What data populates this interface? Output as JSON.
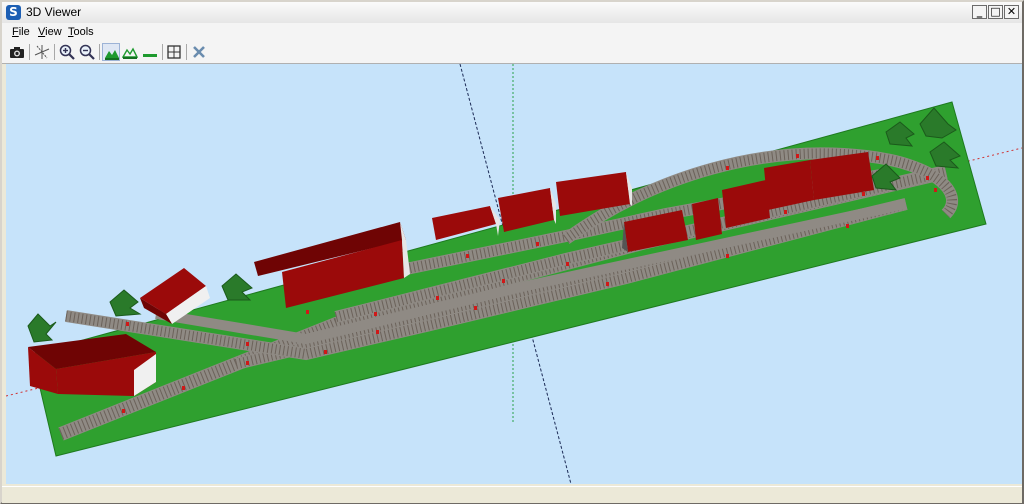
{
  "window": {
    "title": "3D Viewer"
  },
  "controls": {
    "minimize": "_",
    "maximize": "□",
    "close": "✕"
  },
  "menu": [
    {
      "label": "File",
      "accel": "F",
      "rest": "ile"
    },
    {
      "label": "View",
      "accel": "V",
      "rest": "iew"
    },
    {
      "label": "Tools",
      "accel": "T",
      "rest": "ools"
    }
  ],
  "toolbar": {
    "buttons": [
      {
        "icon": "camera-icon"
      },
      {
        "icon": "axes-icon"
      },
      {
        "icon": "zoom-in-icon"
      },
      {
        "icon": "zoom-out-icon"
      },
      {
        "icon": "terrain-view-icon",
        "active": true
      },
      {
        "icon": "terrain-wire-icon"
      },
      {
        "icon": "flat-view-icon"
      },
      {
        "icon": "fit-view-icon"
      },
      {
        "icon": "close-tool-icon"
      }
    ]
  },
  "scene": {
    "sky_color": "#c6e3fa",
    "baseboard_color": "#2fa02f",
    "building_color": "#9b0a0a",
    "roof_color": "#6f0404",
    "wall_light_color": "#f0f0f0",
    "track_color": "#8f8a84",
    "sleeper_color": "#6b625a",
    "tree_color": "#2a7a2a"
  }
}
